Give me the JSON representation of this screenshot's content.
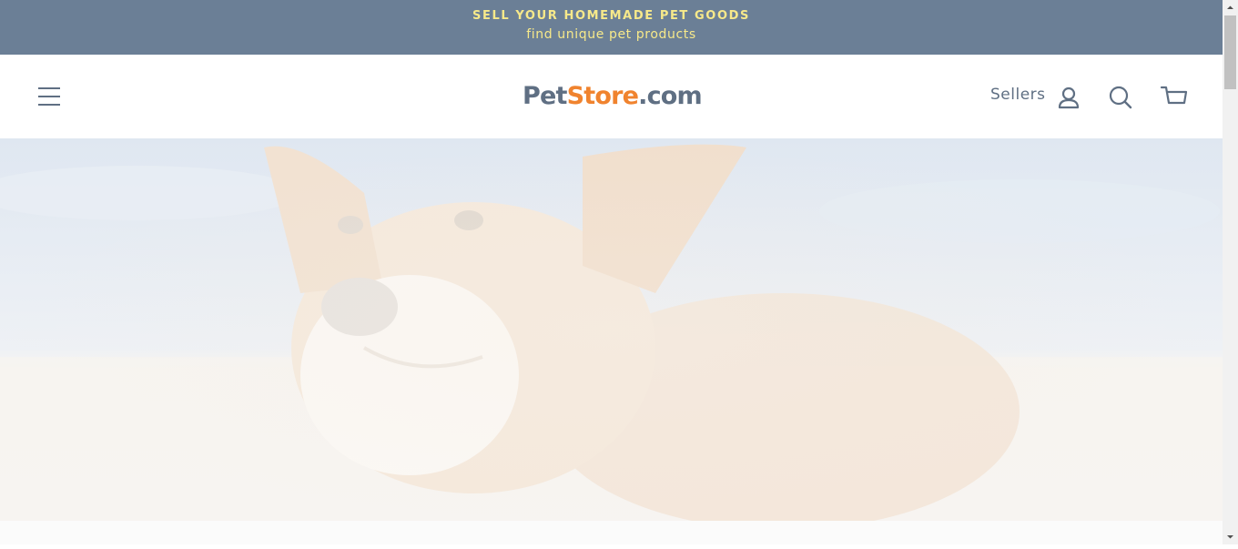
{
  "announcement": {
    "line1": "SELL YOUR HOMEMADE PET GOODS",
    "line2": "find unique pet products"
  },
  "header": {
    "menu_icon": "hamburger-menu-icon",
    "logo": {
      "part1": "Pet",
      "part2": "Store",
      "part3": ".com"
    },
    "sellers_label": "Sellers",
    "account_icon": "user-icon",
    "search_icon": "search-icon",
    "cart_icon": "cart-icon"
  },
  "hero": {
    "image": "corgi-dog-on-beach"
  },
  "colors": {
    "announcement_bg": "#6b7f96",
    "announcement_text": "#f7e98a",
    "brand_gray": "#5f6f83",
    "brand_orange": "#f0832e"
  }
}
